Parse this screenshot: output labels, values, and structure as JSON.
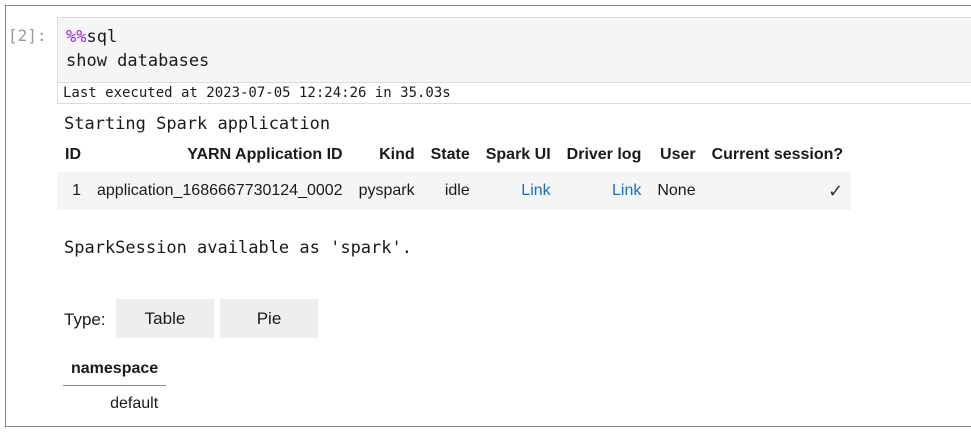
{
  "cell": {
    "prompt": "[2]:",
    "code_magic": "%%",
    "code_magic_rest": "sql",
    "code_line2": "show databases",
    "last_executed": "Last executed at 2023-07-05 12:24:26 in 35.03s"
  },
  "output": {
    "starting_text": "Starting Spark application",
    "spark_table": {
      "headers": [
        "ID",
        "YARN Application ID",
        "Kind",
        "State",
        "Spark UI",
        "Driver log",
        "User",
        "Current session?"
      ],
      "row": {
        "id": "1",
        "yarn_app_id": "application_1686667730124_0002",
        "kind": "pyspark",
        "state": "idle",
        "spark_ui": "Link",
        "driver_log": "Link",
        "user": "None",
        "current_session": "✓"
      }
    },
    "session_text": "SparkSession available as 'spark'.",
    "type_label": "Type:",
    "type_buttons": [
      "Table",
      "Pie"
    ],
    "result_table": {
      "header": "namespace",
      "rows": [
        "default"
      ]
    }
  },
  "colors": {
    "magic": "#a020f0",
    "link": "#1a6fc4",
    "code_bg": "#f5f5f5",
    "button_bg": "#eeeeee"
  }
}
